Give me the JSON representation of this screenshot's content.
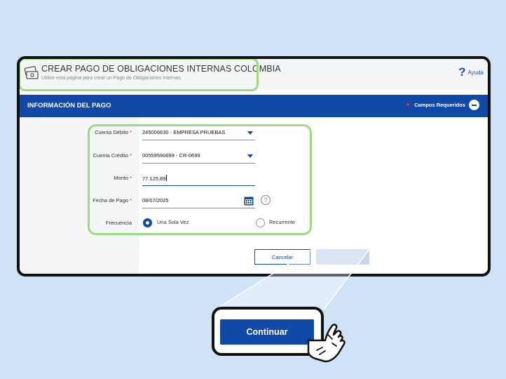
{
  "header": {
    "title": "CREAR PAGO DE OBLIGACIONES INTERNAS COLOMBIA",
    "subtitle": "Utilice esta página para crear un Pago de Obligaciones Internas.",
    "help_label": "Ayuda",
    "help_icon": "question-mark-icon"
  },
  "section": {
    "title": "INFORMACIÓN DEL PAGO",
    "required_label": "Campos Requeridos"
  },
  "form": {
    "cuenta_debito": {
      "label": "Cuenta Débito",
      "value": "245006630 - EMPRESA PRUEBAS"
    },
    "cuenta_credito": {
      "label": "Cuenta Crédito",
      "value": "00559590699 - CR-0699"
    },
    "monto": {
      "label": "Monto",
      "value": "77.125,89"
    },
    "fecha_pago": {
      "label": "Fecha de Pago",
      "value": "08/07/2025"
    },
    "frecuencia": {
      "label": "Frecuencia",
      "options": [
        "Una Sola Vez",
        "Recurrente"
      ],
      "selected": "Una Sola Vez"
    }
  },
  "actions": {
    "cancel_label": "Cancelar",
    "continue_label": "Continuar"
  },
  "colors": {
    "primary": "#1049a8",
    "highlight": "#9bdc7e",
    "background": "#cfe2f6"
  }
}
